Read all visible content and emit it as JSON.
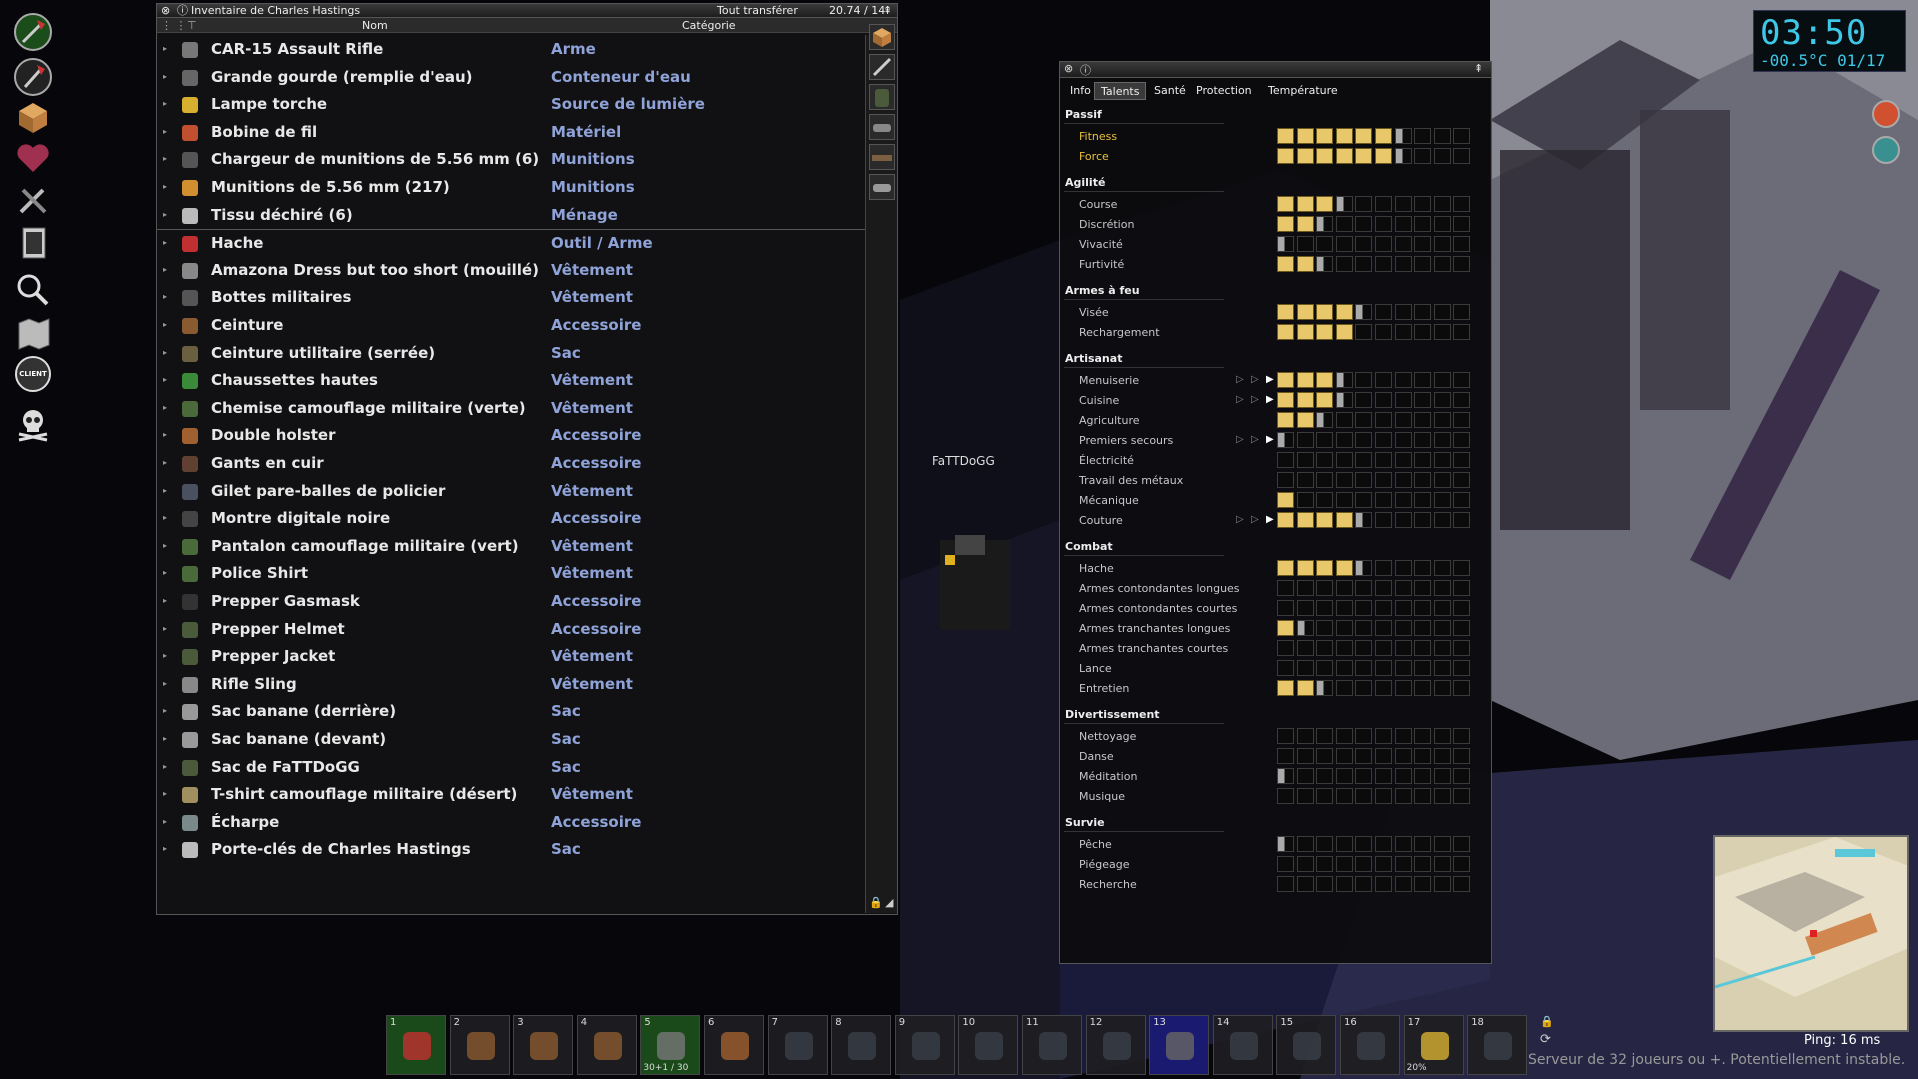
{
  "inventory": {
    "title": "Inventaire de Charles Hastings",
    "transfer_all": "Tout transférer",
    "weight": "20.74 / 14",
    "col_name": "Nom",
    "col_category": "Catégorie",
    "items": [
      {
        "name": "CAR-15 Assault Rifle",
        "category": "Arme",
        "icon": "rifle-icon"
      },
      {
        "name": "Grande gourde (remplie d'eau)",
        "category": "Conteneur d'eau",
        "icon": "canteen-icon"
      },
      {
        "name": "Lampe torche",
        "category": "Source de lumière",
        "icon": "flashlight-icon"
      },
      {
        "name": "Bobine de fil",
        "category": "Matériel",
        "icon": "wire-spool-icon"
      },
      {
        "name": "Chargeur de munitions de 5.56 mm (6)",
        "category": "Munitions",
        "icon": "magazine-icon"
      },
      {
        "name": "Munitions de 5.56 mm (217)",
        "category": "Munitions",
        "icon": "ammo-icon"
      },
      {
        "name": "Tissu déchiré (6)",
        "category": "Ménage",
        "icon": "rag-icon"
      },
      {
        "name": "Hache",
        "category": "Outil / Arme",
        "icon": "axe-icon"
      },
      {
        "name": "Amazona Dress but too short (mouillé)",
        "category": "Vêtement",
        "icon": "dress-icon"
      },
      {
        "name": "Bottes militaires",
        "category": "Vêtement",
        "icon": "boots-icon"
      },
      {
        "name": "Ceinture",
        "category": "Accessoire",
        "icon": "belt-icon"
      },
      {
        "name": "Ceinture utilitaire (serrée)",
        "category": "Sac",
        "icon": "utility-belt-icon"
      },
      {
        "name": "Chaussettes hautes",
        "category": "Vêtement",
        "icon": "socks-icon"
      },
      {
        "name": "Chemise camouflage militaire (verte)",
        "category": "Vêtement",
        "icon": "shirt-icon"
      },
      {
        "name": "Double holster",
        "category": "Accessoire",
        "icon": "holster-icon"
      },
      {
        "name": "Gants en cuir",
        "category": "Accessoire",
        "icon": "gloves-icon"
      },
      {
        "name": "Gilet pare-balles de policier",
        "category": "Vêtement",
        "icon": "vest-icon"
      },
      {
        "name": "Montre digitale noire",
        "category": "Accessoire",
        "icon": "watch-icon"
      },
      {
        "name": "Pantalon camouflage militaire (vert)",
        "category": "Vêtement",
        "icon": "pants-icon"
      },
      {
        "name": "Police Shirt",
        "category": "Vêtement",
        "icon": "shirt-icon"
      },
      {
        "name": "Prepper Gasmask",
        "category": "Accessoire",
        "icon": "gasmask-icon"
      },
      {
        "name": "Prepper Helmet",
        "category": "Accessoire",
        "icon": "helmet-icon"
      },
      {
        "name": "Prepper Jacket",
        "category": "Vêtement",
        "icon": "jacket-icon"
      },
      {
        "name": "Rifle Sling",
        "category": "Vêtement",
        "icon": "sling-icon"
      },
      {
        "name": "Sac banane (derrière)",
        "category": "Sac",
        "icon": "fannypack-icon"
      },
      {
        "name": "Sac banane (devant)",
        "category": "Sac",
        "icon": "fannypack-icon"
      },
      {
        "name": "Sac de FaTTDoGG",
        "category": "Sac",
        "icon": "backpack-icon"
      },
      {
        "name": "T-shirt camouflage militaire (désert)",
        "category": "Vêtement",
        "icon": "tshirt-icon"
      },
      {
        "name": "Écharpe",
        "category": "Accessoire",
        "icon": "scarf-icon"
      },
      {
        "name": "Porte-clés de Charles Hastings",
        "category": "Sac",
        "icon": "keyring-icon"
      }
    ]
  },
  "player_name": "FaTTDoGG",
  "character": {
    "tabs": [
      "Info",
      "Talents",
      "Santé",
      "Protection",
      "Température"
    ],
    "active_tab": "Talents",
    "categories": [
      {
        "name": "Passif",
        "skills": [
          {
            "name": "Fitness",
            "level": 6.5,
            "highlight": true
          },
          {
            "name": "Force",
            "level": 6.5,
            "highlight": true
          }
        ]
      },
      {
        "name": "Agilité",
        "skills": [
          {
            "name": "Course",
            "level": 3.5
          },
          {
            "name": "Discrétion",
            "level": 2.3
          },
          {
            "name": "Vivacité",
            "level": 0.5
          },
          {
            "name": "Furtivité",
            "level": 2.3
          }
        ]
      },
      {
        "name": "Armes à feu",
        "skills": [
          {
            "name": "Visée",
            "level": 4.6
          },
          {
            "name": "Rechargement",
            "level": 4.0
          }
        ]
      },
      {
        "name": "Artisanat",
        "skills": [
          {
            "name": "Menuiserie",
            "level": 3.4,
            "boost": true
          },
          {
            "name": "Cuisine",
            "level": 3.5,
            "boost": true
          },
          {
            "name": "Agriculture",
            "level": 2.4
          },
          {
            "name": "Premiers secours",
            "level": 0.6,
            "boost": true
          },
          {
            "name": "Électricité",
            "level": 0
          },
          {
            "name": "Travail des métaux",
            "level": 0
          },
          {
            "name": "Mécanique",
            "level": 1.0
          },
          {
            "name": "Couture",
            "level": 4.3,
            "boost": true
          }
        ]
      },
      {
        "name": "Combat",
        "skills": [
          {
            "name": "Hache",
            "level": 4.6
          },
          {
            "name": "Armes contondantes longues",
            "level": 0
          },
          {
            "name": "Armes contondantes courtes",
            "level": 0
          },
          {
            "name": "Armes tranchantes longues",
            "level": 1.5
          },
          {
            "name": "Armes tranchantes courtes",
            "level": 0
          },
          {
            "name": "Lance",
            "level": 0
          },
          {
            "name": "Entretien",
            "level": 2.7
          }
        ]
      },
      {
        "name": "Divertissement",
        "skills": [
          {
            "name": "Nettoyage",
            "level": 0
          },
          {
            "name": "Danse",
            "level": 0
          },
          {
            "name": "Méditation",
            "level": 0.4
          },
          {
            "name": "Musique",
            "level": 0
          }
        ]
      },
      {
        "name": "Survie",
        "skills": [
          {
            "name": "Pêche",
            "level": 0.6
          },
          {
            "name": "Piégeage",
            "level": 0
          },
          {
            "name": "Recherche",
            "level": 0
          }
        ]
      }
    ]
  },
  "clock": {
    "time": "03:50",
    "temp_date": "-00.5°C 01/17"
  },
  "hotbar": [
    {
      "n": "1",
      "icon": "axe-icon"
    },
    {
      "n": "2",
      "icon": "belt-icon"
    },
    {
      "n": "3",
      "icon": "belt-icon"
    },
    {
      "n": "4",
      "icon": "belt-icon"
    },
    {
      "n": "5",
      "icon": "rifle-icon",
      "sub": "30+1 / 30"
    },
    {
      "n": "6",
      "icon": "holster-icon"
    },
    {
      "n": "7",
      "icon": "bag-icon"
    },
    {
      "n": "8",
      "icon": "bag-icon"
    },
    {
      "n": "9",
      "icon": "bag-icon"
    },
    {
      "n": "10",
      "icon": "bag-icon"
    },
    {
      "n": "11",
      "icon": "bag-icon"
    },
    {
      "n": "12",
      "icon": "bag-icon"
    },
    {
      "n": "13",
      "icon": "canteen-icon"
    },
    {
      "n": "14",
      "icon": "bag-icon"
    },
    {
      "n": "15",
      "icon": "bag-icon"
    },
    {
      "n": "16",
      "icon": "bag-icon"
    },
    {
      "n": "17",
      "icon": "flashlight-icon",
      "sub": "20%"
    },
    {
      "n": "18",
      "icon": "bag-icon"
    }
  ],
  "ping": "Ping: 16 ms",
  "server_warning": "Serveur de 32 joueurs ou +. Potentiellement instable.",
  "client_badge": "CLIENT"
}
